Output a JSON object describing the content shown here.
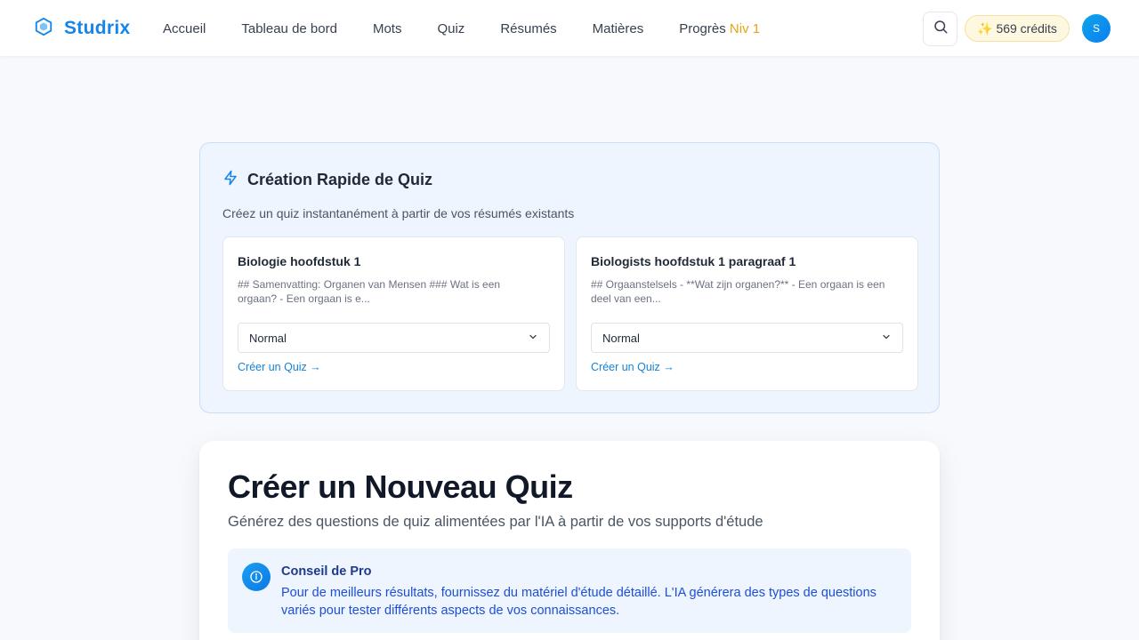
{
  "header": {
    "brand": "Studrix",
    "nav": [
      {
        "label": "Accueil"
      },
      {
        "label": "Tableau de bord"
      },
      {
        "label": "Mots"
      },
      {
        "label": "Quiz"
      },
      {
        "label": "Résumés"
      },
      {
        "label": "Matières"
      },
      {
        "label": "Progrès",
        "badge": "Niv 1"
      }
    ],
    "credits": "569 crédits",
    "credits_icon": "sparkles-icon",
    "avatar_initial": "S"
  },
  "quick_quiz": {
    "title": "Création Rapide de Quiz",
    "subtitle": "Créez un quiz instantanément à partir de vos résumés existants",
    "cards": [
      {
        "title": "Biologie hoofdstuk 1",
        "excerpt": "## Samenvatting: Organen van Mensen ### Wat is een orgaan? - Een orgaan is e...",
        "difficulty": "Normal",
        "link": "Créer un Quiz →"
      },
      {
        "title": "Biologists hoofdstuk 1 paragraaf 1",
        "excerpt": "## Orgaanstelsels - **Wat zijn organen?** - Een orgaan is een deel van een...",
        "difficulty": "Normal",
        "link": "Créer un Quiz →"
      }
    ]
  },
  "create": {
    "title": "Créer un Nouveau Quiz",
    "subtitle": "Générez des questions de quiz alimentées par l'IA à partir de vos supports d'étude",
    "tip": {
      "title": "Conseil de Pro",
      "text": "Pour de meilleurs résultats, fournissez du matériel d'étude détaillé. L'IA générera des types de questions variés pour tester différents aspects de vos connaissances."
    }
  },
  "colors": {
    "brand": "#1585e8",
    "accent_level": "#e6a415",
    "link": "#1683d6",
    "tip_text": "#1d4ed8"
  }
}
